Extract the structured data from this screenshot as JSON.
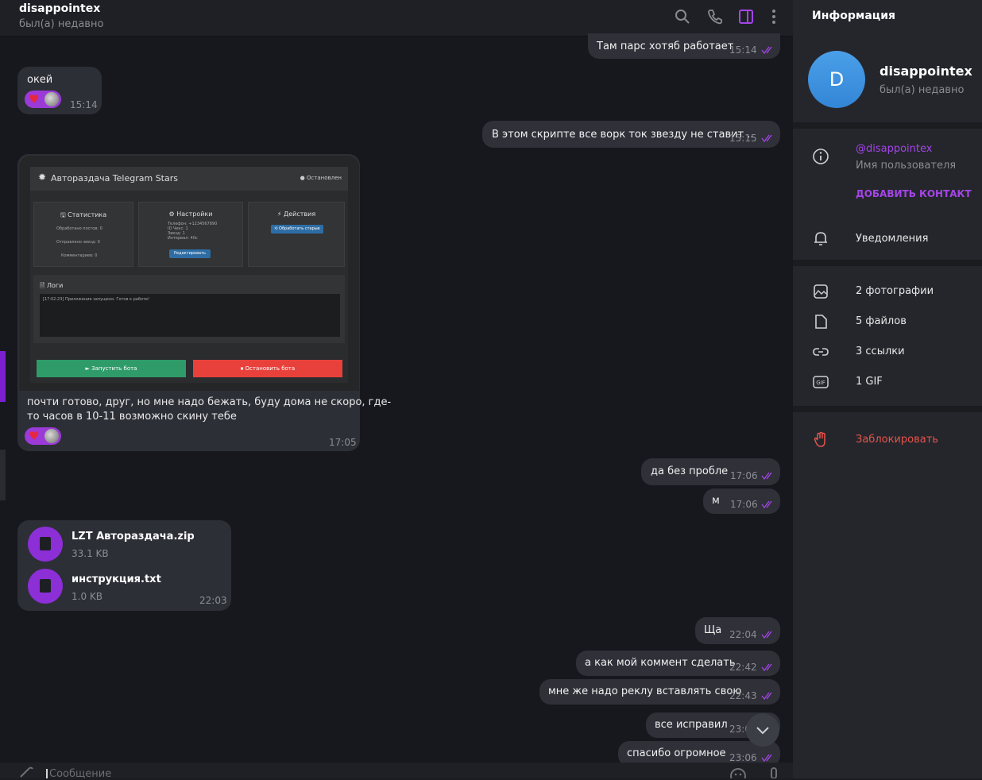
{
  "header": {
    "name": "disappointex",
    "status": "был(а) недавно"
  },
  "messages": {
    "m1": {
      "text": "Там парс хотяб работает",
      "time": "15:14"
    },
    "m2": {
      "text": "окей",
      "time": "15:14"
    },
    "m3": {
      "text": "В этом скрипте все ворк ток звезду не ставит ..",
      "time": "15:15"
    },
    "m4": {
      "text_line1": "почти готово, друг, но мне надо бежать, буду дома не скоро, где-",
      "text_line2": "то часов в 10-11 возможно скину тебе",
      "time": "17:05"
    },
    "m5": {
      "text": "да без пробле",
      "time": "17:06"
    },
    "m6": {
      "text": "м",
      "time": "17:06"
    },
    "m7": {
      "time": "22:03"
    },
    "m8": {
      "text": "Ща",
      "time": "22:04"
    },
    "m9": {
      "text": "а как мой коммент сделать",
      "time": "22:42"
    },
    "m10": {
      "text": "мне же надо реклу вставлять свою",
      "time": "22:43"
    },
    "m11": {
      "text": "все исправил",
      "time": "23:0"
    },
    "m12": {
      "text": "спасибо огромное",
      "time": "23:06"
    }
  },
  "files": [
    {
      "name": "LZT Автораздача.zip",
      "size": "33.1 KB"
    },
    {
      "name": "инструкция.txt",
      "size": "1.0 KB"
    }
  ],
  "screenshot": {
    "title": "Автораздача Telegram Stars",
    "state": "● Остановлен",
    "stats_title": "🖫 Статистика",
    "stats": [
      "Обработано постов: 0",
      "Отправлено звезд: 0",
      "Комментариев: 0"
    ],
    "settings_title": "⚙ Настройки",
    "settings": [
      "Телефон: +1234567890",
      "ID Чекс: 1",
      "Звезд: 1",
      "Интервал: 40с"
    ],
    "edit_btn": "Редактировать",
    "actions_title": "⚡ Действия",
    "process_btn": "⟲ Обработать старые",
    "logs_title": "🗎 Логи",
    "log_line": "[17:02:23] Приложение запущено. Готов к работе!",
    "start_btn": "►     Запустить бота",
    "stop_btn": "⏹ Остановить бота"
  },
  "input": {
    "placeholder": "Сообщение"
  },
  "sidebar": {
    "title": "Информация",
    "avatar_letter": "D",
    "name": "disappointex",
    "status": "был(а) недавно",
    "username": "@disappointex",
    "username_label": "Имя пользователя",
    "add_contact": "ДОБАВИТЬ КОНТАКТ",
    "notifications": "Уведомления",
    "photos": "2 фотографии",
    "files": "5 файлов",
    "links": "3 ссылки",
    "gifs": "1 GIF",
    "block": "Заблокировать"
  },
  "colors": {
    "accent": "#a445e8",
    "danger": "#e5534b",
    "avatar": "#3d8fdc"
  }
}
